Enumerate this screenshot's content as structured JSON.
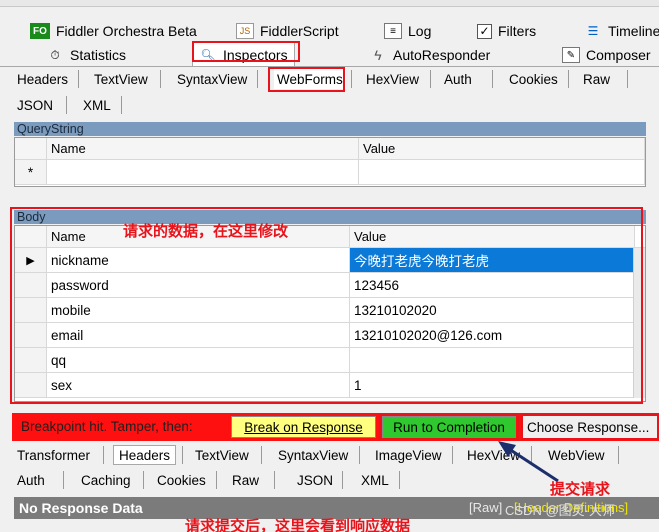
{
  "top_tabs_row1": [
    "Fiddler Orchestra Beta",
    "FiddlerScript",
    "Log",
    "Filters",
    "Timeline"
  ],
  "top_tabs_row2": [
    "Statistics",
    "Inspectors",
    "AutoResponder",
    "Composer"
  ],
  "request_subtabs_row1": [
    "Headers",
    "TextView",
    "SyntaxView",
    "WebForms",
    "HexView",
    "Auth",
    "Cookies",
    "Raw"
  ],
  "request_subtabs_row2": [
    "JSON",
    "XML"
  ],
  "querystring": {
    "title": "QueryString",
    "col_name": "Name",
    "col_value": "Value",
    "new_row_marker": "*"
  },
  "body": {
    "title": "Body",
    "col_name": "Name",
    "col_value": "Value",
    "current_row_marker": "▶",
    "rows": [
      {
        "name": "nickname",
        "value": "今晚打老虎今晚打老虎"
      },
      {
        "name": "password",
        "value": "123456"
      },
      {
        "name": "mobile",
        "value": "13210102020"
      },
      {
        "name": "email",
        "value": "13210102020@126.com"
      },
      {
        "name": "qq",
        "value": ""
      },
      {
        "name": "sex",
        "value": "1"
      }
    ]
  },
  "annotations": {
    "body_note": "请求的数据，在这里修改",
    "submit_note": "提交请求",
    "response_note": "请求提交后，这里会看到响应数据"
  },
  "breakpoint": {
    "message": "Breakpoint hit. Tamper, then:",
    "break_on_response": "Break on Response",
    "run_to_completion": "Run to Completion",
    "choose_response": "Choose Response..."
  },
  "response_subtabs_row1": [
    "Transformer",
    "Headers",
    "TextView",
    "SyntaxView",
    "ImageView",
    "HexView",
    "WebView"
  ],
  "response_subtabs_row2": [
    "Auth",
    "Caching",
    "Cookies",
    "Raw",
    "JSON",
    "XML"
  ],
  "response": {
    "label": "No Response Data",
    "raw_link": "[Raw]",
    "header_defs": "[Header Definitions]"
  },
  "watermark": "CSDN @图灵·大师",
  "colors": {
    "highlight_red": "#e8141b",
    "run_green": "#2fc82f",
    "break_yellow": "#ffff80",
    "selection_blue": "#0a79d8",
    "panel_blue": "#7a9bbd"
  }
}
